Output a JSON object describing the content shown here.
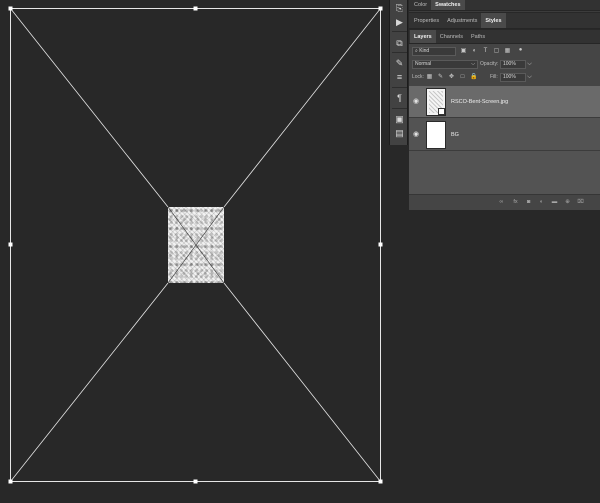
{
  "color_panel": {
    "tabs": [
      "Color",
      "Swatches"
    ],
    "active": 1
  },
  "properties_panel": {
    "tabs": [
      "Properties",
      "Adjustments",
      "Styles"
    ],
    "active": 2
  },
  "layers_panel": {
    "tabs": [
      "Layers",
      "Channels",
      "Paths"
    ],
    "active": 0,
    "filter_placeholder": "Kind",
    "blend_mode": "Normal",
    "opacity_label": "Opacity:",
    "opacity_value": "100%",
    "lock_label": "Lock:",
    "fill_label": "Fill:",
    "fill_value": "100%",
    "layers": [
      {
        "name": "RSCO-Bent-Screen.jpg",
        "selected": true
      },
      {
        "name": "BG",
        "selected": false
      }
    ]
  },
  "colors": {
    "canvas_bg": "#282828",
    "panel_bg": "#3c3c3c",
    "selected_row": "#6a6a6a",
    "transform_line": "#e6e6e6"
  }
}
